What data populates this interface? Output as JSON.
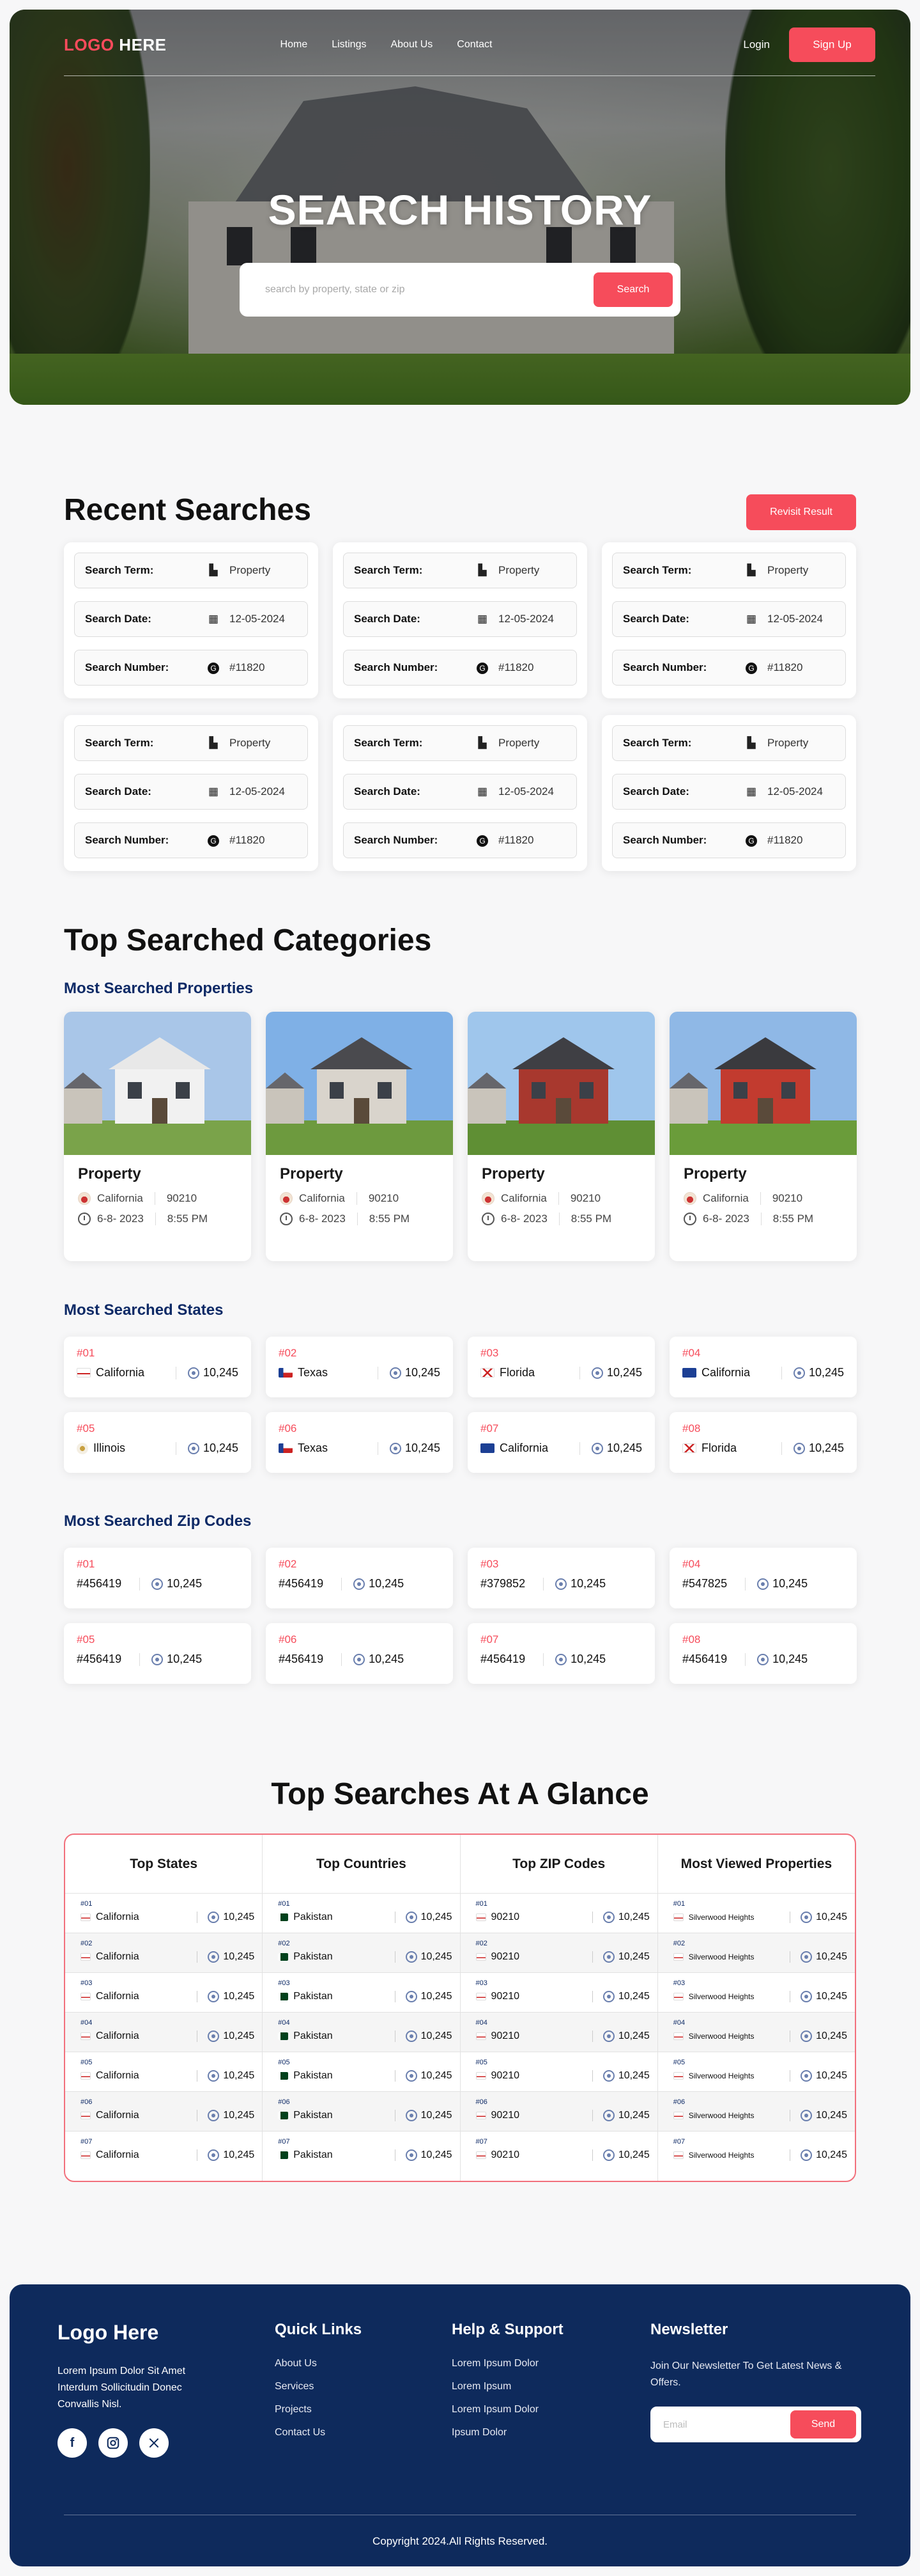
{
  "brand": {
    "logo_left": "LOGO",
    "logo_right": " HERE",
    "accent": "#f64c5b",
    "navy": "#0e2a5c"
  },
  "nav": {
    "links": [
      "Home",
      "Listings",
      "About Us",
      "Contact"
    ],
    "login": "Login",
    "signup": "Sign Up"
  },
  "hero": {
    "title": "SEARCH HISTORY",
    "search_placeholder": "search by property, state or zip",
    "search_button": "Search"
  },
  "recent": {
    "title": "Recent Searches",
    "revisit_button": "Revisit Result",
    "labels": {
      "term": "Search Term:",
      "date": "Search Date:",
      "number": "Search Number:"
    },
    "icons": {
      "term": "building-icon",
      "date": "calendar-icon",
      "number": "hash-circle-icon"
    },
    "cards": [
      {
        "term": "Property",
        "date": "12-05-2024",
        "number": "#11820"
      },
      {
        "term": "Property",
        "date": "12-05-2024",
        "number": "#11820"
      },
      {
        "term": "Property",
        "date": "12-05-2024",
        "number": "#11820"
      },
      {
        "term": "Property",
        "date": "12-05-2024",
        "number": "#11820"
      },
      {
        "term": "Property",
        "date": "12-05-2024",
        "number": "#11820"
      },
      {
        "term": "Property",
        "date": "12-05-2024",
        "number": "#11820"
      }
    ]
  },
  "categories": {
    "title": "Top Searched Categories",
    "properties_title": "Most Searched Properties",
    "properties": [
      {
        "name": "Property",
        "state": "California",
        "zip": "90210",
        "date": "6-8- 2023",
        "time": "8:55 PM"
      },
      {
        "name": "Property",
        "state": "California",
        "zip": "90210",
        "date": "6-8- 2023",
        "time": "8:55 PM"
      },
      {
        "name": "Property",
        "state": "California",
        "zip": "90210",
        "date": "6-8- 2023",
        "time": "8:55 PM"
      },
      {
        "name": "Property",
        "state": "California",
        "zip": "90210",
        "date": "6-8- 2023",
        "time": "8:55 PM"
      }
    ],
    "states_title": "Most Searched States",
    "states": [
      {
        "rank": "#01",
        "name": "California",
        "flag": "ca",
        "views": "10,245"
      },
      {
        "rank": "#02",
        "name": "Texas",
        "flag": "tx",
        "views": "10,245"
      },
      {
        "rank": "#03",
        "name": "Florida",
        "flag": "fl",
        "views": "10,245"
      },
      {
        "rank": "#04",
        "name": "California",
        "flag": "ca2",
        "views": "10,245"
      },
      {
        "rank": "#05",
        "name": "Illinois",
        "flag": "il",
        "views": "10,245"
      },
      {
        "rank": "#06",
        "name": "Texas",
        "flag": "tx",
        "views": "10,245"
      },
      {
        "rank": "#07",
        "name": "California",
        "flag": "ca2",
        "views": "10,245"
      },
      {
        "rank": "#08",
        "name": "Florida",
        "flag": "fl",
        "views": "10,245"
      }
    ],
    "zips_title": "Most Searched Zip Codes",
    "zips": [
      {
        "rank": "#01",
        "zip": "#456419",
        "views": "10,245"
      },
      {
        "rank": "#02",
        "zip": "#456419",
        "views": "10,245"
      },
      {
        "rank": "#03",
        "zip": "#379852",
        "views": "10,245"
      },
      {
        "rank": "#04",
        "zip": "#547825",
        "views": "10,245"
      },
      {
        "rank": "#05",
        "zip": "#456419",
        "views": "10,245"
      },
      {
        "rank": "#06",
        "zip": "#456419",
        "views": "10,245"
      },
      {
        "rank": "#07",
        "zip": "#456419",
        "views": "10,245"
      },
      {
        "rank": "#08",
        "zip": "#456419",
        "views": "10,245"
      }
    ]
  },
  "glance": {
    "title": "Top Searches At A Glance",
    "columns": [
      {
        "header": "Top States",
        "flag": "ca",
        "rows": [
          {
            "rank": "#01",
            "name": "California",
            "views": "10,245"
          },
          {
            "rank": "#02",
            "name": "California",
            "views": "10,245"
          },
          {
            "rank": "#03",
            "name": "California",
            "views": "10,245"
          },
          {
            "rank": "#04",
            "name": "California",
            "views": "10,245"
          },
          {
            "rank": "#05",
            "name": "California",
            "views": "10,245"
          },
          {
            "rank": "#06",
            "name": "California",
            "views": "10,245"
          },
          {
            "rank": "#07",
            "name": "California",
            "views": "10,245"
          }
        ]
      },
      {
        "header": "Top Countries",
        "flag": "pk",
        "rows": [
          {
            "rank": "#01",
            "name": "Pakistan",
            "views": "10,245"
          },
          {
            "rank": "#02",
            "name": "Pakistan",
            "views": "10,245"
          },
          {
            "rank": "#03",
            "name": "Pakistan",
            "views": "10,245"
          },
          {
            "rank": "#04",
            "name": "Pakistan",
            "views": "10,245"
          },
          {
            "rank": "#05",
            "name": "Pakistan",
            "views": "10,245"
          },
          {
            "rank": "#06",
            "name": "Pakistan",
            "views": "10,245"
          },
          {
            "rank": "#07",
            "name": "Pakistan",
            "views": "10,245"
          }
        ]
      },
      {
        "header": "Top ZIP Codes",
        "flag": "ca",
        "rows": [
          {
            "rank": "#01",
            "name": "90210",
            "views": "10,245"
          },
          {
            "rank": "#02",
            "name": "90210",
            "views": "10,245"
          },
          {
            "rank": "#03",
            "name": "90210",
            "views": "10,245"
          },
          {
            "rank": "#04",
            "name": "90210",
            "views": "10,245"
          },
          {
            "rank": "#05",
            "name": "90210",
            "views": "10,245"
          },
          {
            "rank": "#06",
            "name": "90210",
            "views": "10,245"
          },
          {
            "rank": "#07",
            "name": "90210",
            "views": "10,245"
          }
        ]
      },
      {
        "header": "Most Viewed Properties",
        "flag": "ca",
        "small": true,
        "rows": [
          {
            "rank": "#01",
            "name": "Silverwood Heights",
            "views": "10,245"
          },
          {
            "rank": "#02",
            "name": "Silverwood Heights",
            "views": "10,245"
          },
          {
            "rank": "#03",
            "name": "Silverwood Heights",
            "views": "10,245"
          },
          {
            "rank": "#04",
            "name": "Silverwood Heights",
            "views": "10,245"
          },
          {
            "rank": "#05",
            "name": "Silverwood Heights",
            "views": "10,245"
          },
          {
            "rank": "#06",
            "name": "Silverwood Heights",
            "views": "10,245"
          },
          {
            "rank": "#07",
            "name": "Silverwood Heights",
            "views": "10,245"
          }
        ]
      }
    ]
  },
  "footer": {
    "logo": "Logo Here",
    "description": "Lorem Ipsum Dolor Sit Amet Interdum Sollicitudin Donec Convallis Nisl.",
    "socials": [
      "facebook-icon",
      "instagram-icon",
      "x-icon"
    ],
    "quick_links_title": "Quick Links",
    "quick_links": [
      "About Us",
      "Services",
      "Projects",
      "Contact Us"
    ],
    "help_title": "Help & Support",
    "help_links": [
      "Lorem Ipsum Dolor",
      "Lorem Ipsum",
      "Lorem Ipsum Dolor",
      "Ipsum Dolor"
    ],
    "newsletter_title": "Newsletter",
    "newsletter_text": "Join Our Newsletter To Get Latest News & Offers.",
    "email_placeholder": "Email",
    "send_button": "Send",
    "copyright": "Copyright 2024.All Rights Reserved."
  }
}
